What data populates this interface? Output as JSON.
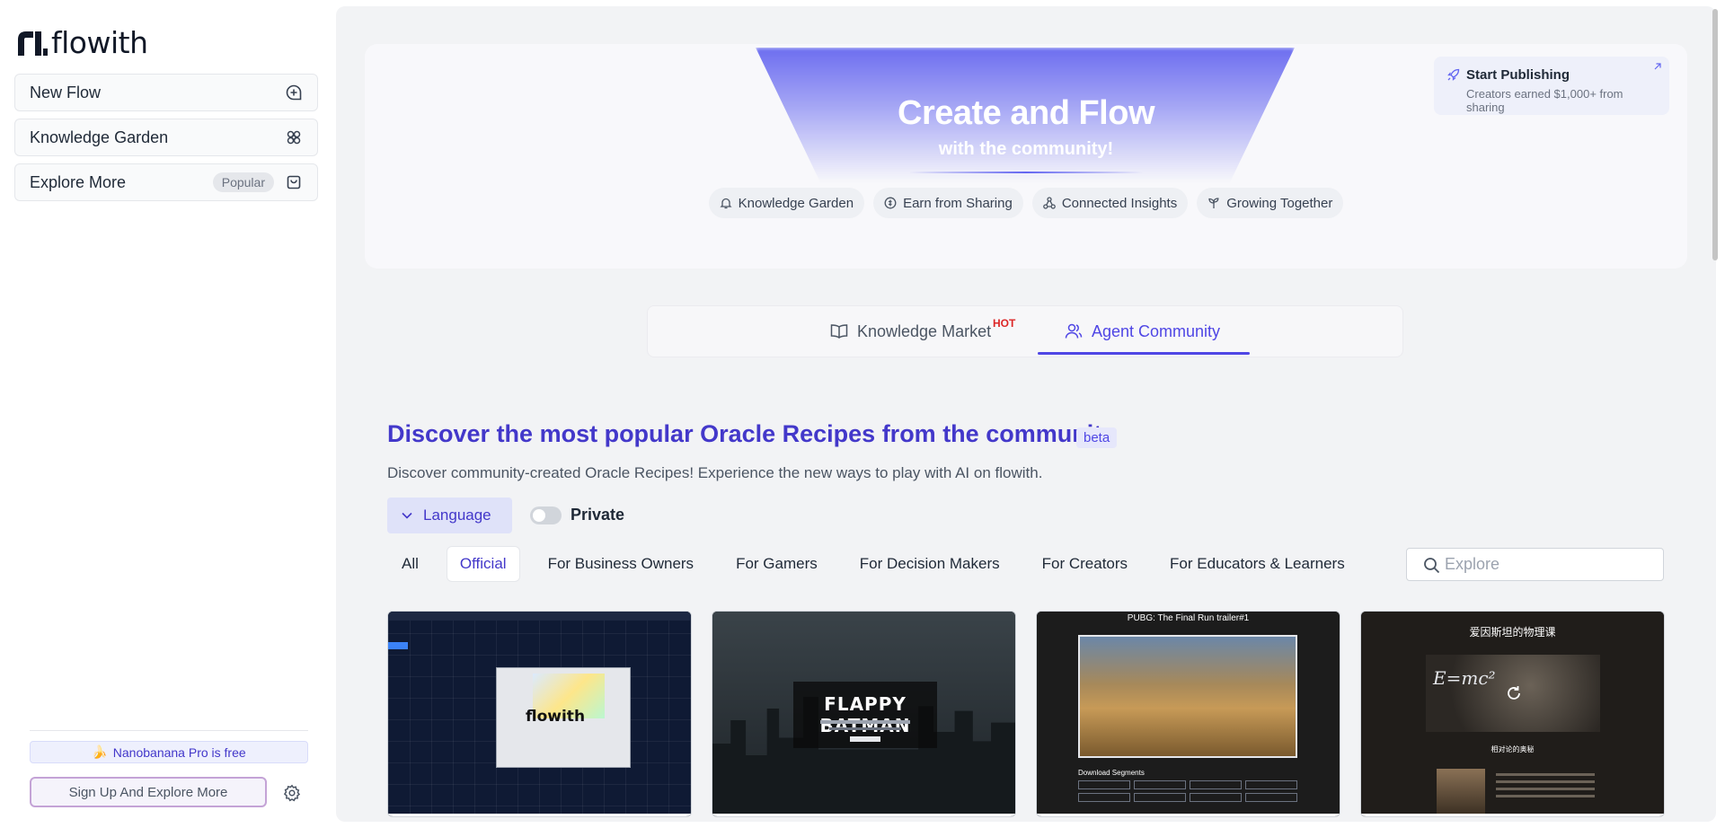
{
  "brand": {
    "name": "flowith"
  },
  "sidebar": {
    "items": [
      {
        "label": "New Flow",
        "icon": "new-chat-icon"
      },
      {
        "label": "Knowledge Garden",
        "icon": "flower-icon"
      },
      {
        "label": "Explore More",
        "badge": "Popular",
        "icon": "shopping-bag-icon"
      }
    ],
    "promo": {
      "emoji": "🍌",
      "text": "Nanobanana Pro is free"
    },
    "signup_label": "Sign Up And Explore More"
  },
  "hero": {
    "title": "Create and Flow",
    "subtitle": "with the community!",
    "chips": [
      {
        "label": "Knowledge Garden",
        "icon": "bell-icon"
      },
      {
        "label": "Earn from Sharing",
        "icon": "coin-icon"
      },
      {
        "label": "Connected Insights",
        "icon": "network-icon"
      },
      {
        "label": "Growing Together",
        "icon": "sprout-icon"
      }
    ],
    "publish": {
      "title": "Start Publishing",
      "subtitle": "Creators earned $1,000+ from sharing"
    }
  },
  "tabs": {
    "knowledge": {
      "label": "Knowledge Market",
      "badge": "HOT"
    },
    "agent": {
      "label": "Agent Community"
    }
  },
  "section": {
    "title": "Discover the most popular Oracle Recipes from the community",
    "badge": "beta",
    "description": "Discover community-created Oracle Recipes! Experience the new ways to play with AI on flowith."
  },
  "controls": {
    "language_label": "Language",
    "private_label": "Private",
    "private_on": false
  },
  "filters": {
    "active": "Official",
    "items": [
      "All",
      "Official",
      "For Business Owners",
      "For Gamers",
      "For Decision Makers",
      "For Creators",
      "For Educators & Learners"
    ]
  },
  "search": {
    "placeholder": "Explore"
  },
  "cards": [
    {
      "logo_text": "flowith"
    },
    {
      "title": "FLAPPY BATMAN"
    },
    {
      "title": "PUBG: The Final Run trailer#1",
      "label": "Download Segments"
    },
    {
      "title": "爱因斯坦的物理课",
      "equation": "E=mc²",
      "label": "相对论的奥秘"
    }
  ],
  "colors": {
    "accent": "#4f46e5",
    "hot": "#dc2626",
    "main_bg": "#f2f3f5"
  }
}
